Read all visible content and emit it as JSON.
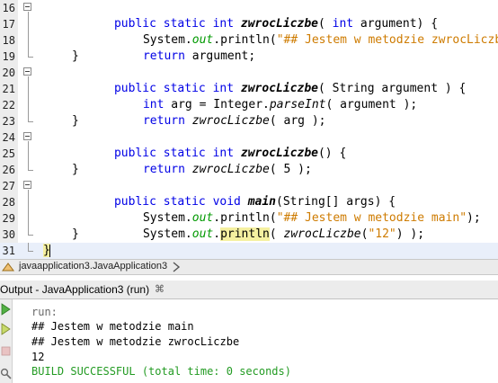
{
  "editor": {
    "lines": [
      {
        "num": "16"
      },
      {
        "num": "17"
      },
      {
        "num": "18"
      },
      {
        "num": "19"
      },
      {
        "num": "20"
      },
      {
        "num": "21"
      },
      {
        "num": "22"
      },
      {
        "num": "23"
      },
      {
        "num": "24"
      },
      {
        "num": "25"
      },
      {
        "num": "26"
      },
      {
        "num": "27"
      },
      {
        "num": "28"
      },
      {
        "num": "29"
      },
      {
        "num": "30"
      },
      {
        "num": "31"
      }
    ],
    "t": {
      "public": "public",
      "static": "static",
      "int": "int",
      "void": "void",
      "return": "return",
      "zwrocLiczbe": "zwrocLiczbe",
      "main": "main",
      "system": "System.",
      "out": "out",
      "println": ".println(",
      "println_word": "println",
      "dot": ".",
      "l16_a": "( ",
      "l16_b": " argument) {",
      "l17_str": "\"## Jestem w metodzie zwrocLiczbe\"",
      "l17_end": ");",
      "l18_rest": " argument;",
      "brace_close": "}",
      "l20_a": "( String argument ) {",
      "l21_a": " arg = Integer.",
      "l21_parse": "parseInt",
      "l21_b": "( argument );",
      "l22_b": "( arg );",
      "l24_a": "() {",
      "l25_b": "( 5 );",
      "l27_a": "(String[] args) {",
      "l28_str": "\"## Jestem w metodzie main\"",
      "l29_a": "( ",
      "l29_str": "\"12\"",
      "l29_b": ") );",
      "l31_brace": "}"
    }
  },
  "navigator": {
    "breadcrumb": "javaapplication3.JavaApplication3"
  },
  "output": {
    "tab_title": "Output - JavaApplication3 (run)",
    "close": "⌘",
    "lines": [
      {
        "text": "run:"
      },
      {
        "text": "## Jestem w metodzie main"
      },
      {
        "text": "## Jestem w metodzie zwrocLiczbe"
      },
      {
        "text": "12"
      },
      {
        "text": "BUILD SUCCESSFUL (total time: 0 seconds)"
      }
    ],
    "colors": {
      "run": "#6a6a6a",
      "success": "#239b23",
      "text": "#000000"
    }
  },
  "icons": {
    "nav_icon": "class-icon",
    "chevron": "chevron-right-icon",
    "rerun": "rerun-icon",
    "rerun_other": "rerun-different-icon",
    "stop": "stop-icon",
    "settings": "settings-icon"
  }
}
